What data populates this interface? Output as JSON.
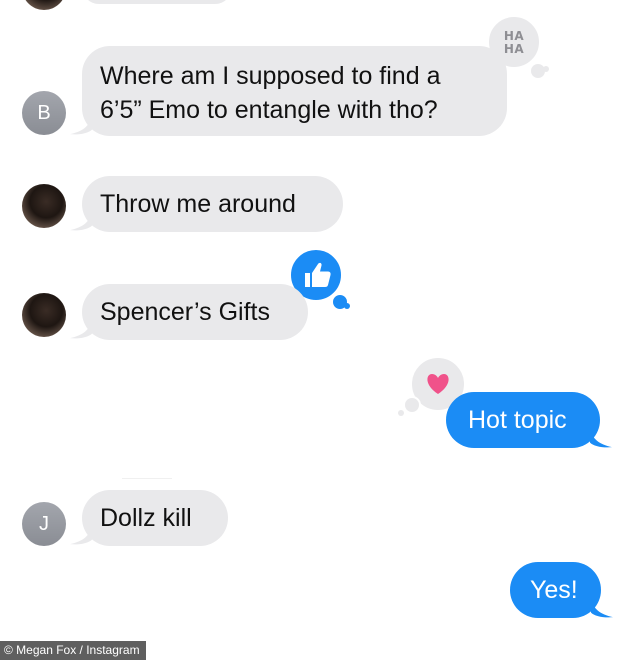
{
  "conversation": {
    "messages": [
      {
        "sender": "B",
        "direction": "incoming",
        "text_line1": "Where am I supposed to find a",
        "text_line2": "6’5” Emo to entangle with tho?",
        "reaction": "haha"
      },
      {
        "sender": "photo",
        "direction": "incoming",
        "text": "Throw me around"
      },
      {
        "sender": "photo",
        "direction": "incoming",
        "text": "Spencer’s Gifts",
        "reaction": "thumbs-up"
      },
      {
        "sender": "me",
        "direction": "outgoing",
        "text": "Hot topic",
        "reaction": "heart"
      },
      {
        "sender": "J",
        "direction": "incoming",
        "text": "Dollz kill"
      },
      {
        "sender": "me",
        "direction": "outgoing",
        "text": "Yes!"
      }
    ],
    "avatars": {
      "b_letter": "B",
      "j_letter": "J"
    },
    "reactions": {
      "haha_line1": "HA",
      "haha_line2": "HA"
    }
  },
  "credit": {
    "text": "© Megan Fox / Instagram"
  },
  "colors": {
    "incoming_bubble": "#e9e9eb",
    "outgoing_bubble": "#1b8cf5",
    "heart": "#f0528a",
    "avatar_gray": "#9a9da4"
  }
}
